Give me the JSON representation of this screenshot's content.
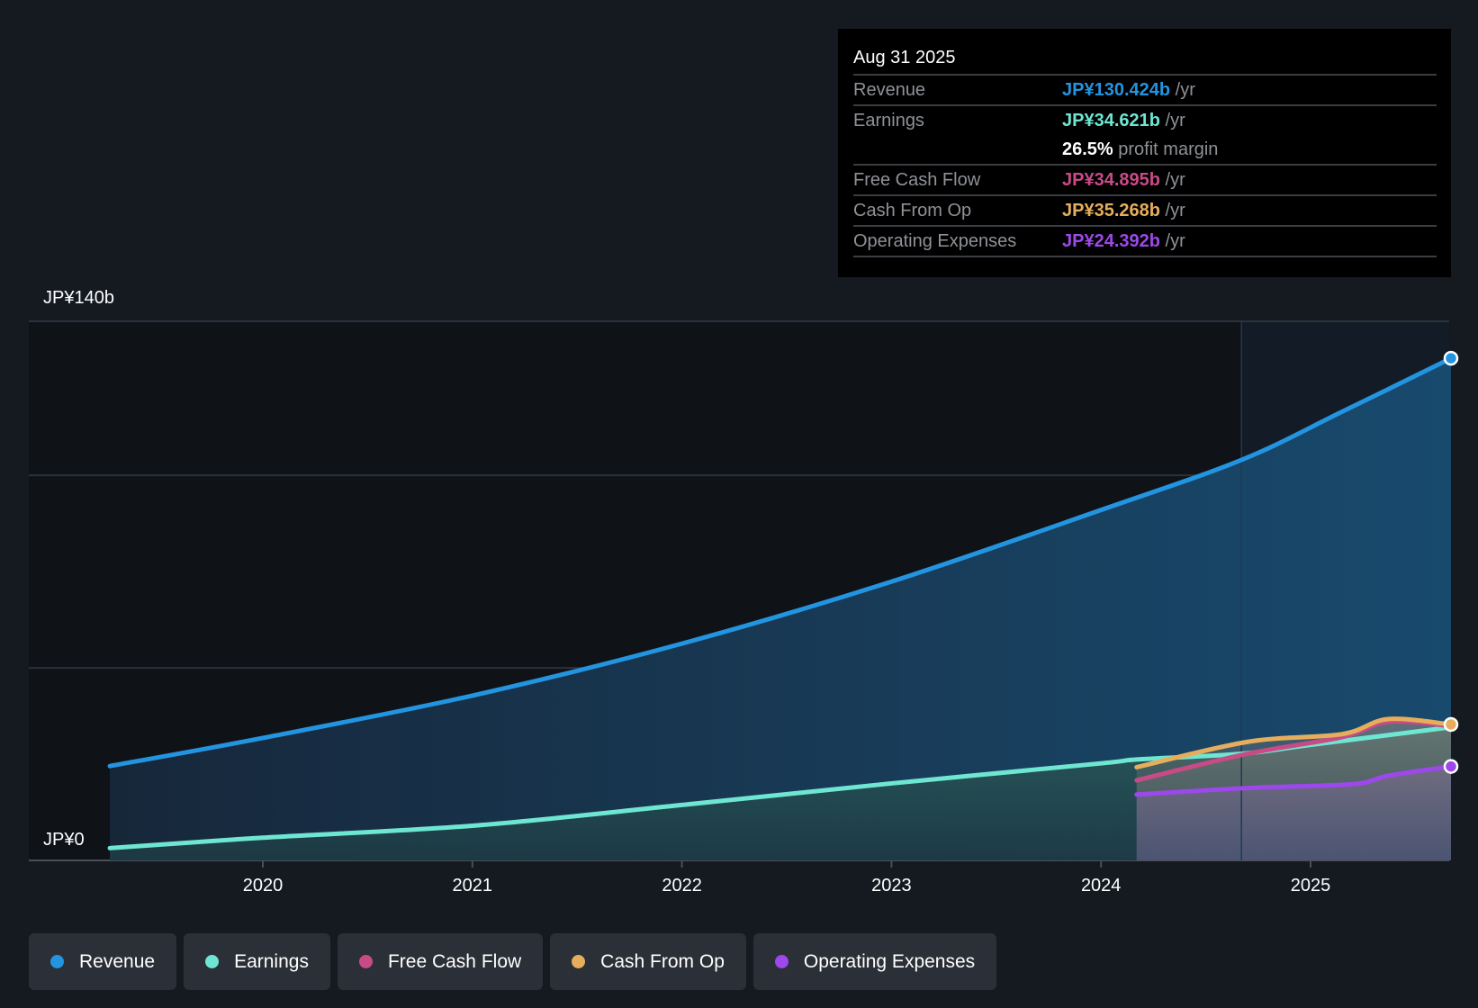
{
  "tooltip": {
    "date": "Aug 31 2025",
    "rows": [
      {
        "label": "Revenue",
        "value": "JP¥130.424b",
        "unit": " /yr",
        "color": "#2394e0"
      },
      {
        "label": "Earnings",
        "value": "JP¥34.621b",
        "unit": " /yr",
        "color": "#6ee6d2"
      },
      {
        "label": "",
        "value": "26.5%",
        "unit": " profit margin",
        "color": "#ffffff"
      },
      {
        "label": "Free Cash Flow",
        "value": "JP¥34.895b",
        "unit": " /yr",
        "color": "#c84b86"
      },
      {
        "label": "Cash From Op",
        "value": "JP¥35.268b",
        "unit": " /yr",
        "color": "#e6ae5c"
      },
      {
        "label": "Operating Expenses",
        "value": "JP¥24.392b",
        "unit": " /yr",
        "color": "#9d48ea"
      }
    ]
  },
  "chart_data": {
    "type": "line",
    "title": "",
    "xlabel": "",
    "ylabel": "",
    "ylim": [
      0,
      140
    ],
    "xlim": [
      2019.27,
      2025.67
    ],
    "y_tick_labels": [
      "JP¥140b",
      "JP¥0"
    ],
    "y_gridlines": [
      0,
      50,
      100,
      140
    ],
    "x_ticks": [
      2020,
      2021,
      2022,
      2023,
      2024,
      2025
    ],
    "x_tick_labels": [
      "2020",
      "2021",
      "2022",
      "2023",
      "2024",
      "2025"
    ],
    "highlight_region_start": 2024.67,
    "series": [
      {
        "name": "Revenue",
        "color": "#2394e0",
        "x": [
          2019.27,
          2020,
          2021,
          2022,
          2023,
          2024,
          2024.67,
          2025.15,
          2025.67
        ],
        "y": [
          24.5,
          31.8,
          42.8,
          56.3,
          72.4,
          91,
          104,
          116.5,
          130.4
        ]
      },
      {
        "name": "Earnings",
        "color": "#6ee6d2",
        "x": [
          2019.27,
          2020,
          2021,
          2022,
          2023,
          2024,
          2024.17,
          2024.67,
          2025,
          2025.67
        ],
        "y": [
          3.2,
          5.9,
          9,
          14.4,
          20,
          25.2,
          26.2,
          27.7,
          30,
          34.6
        ]
      },
      {
        "name": "Free Cash Flow",
        "color": "#c84b86",
        "x": [
          2024.17,
          2024.7,
          2025.15,
          2025.37,
          2025.67
        ],
        "y": [
          20.8,
          27.7,
          32,
          36,
          34.9
        ]
      },
      {
        "name": "Cash From Op",
        "color": "#e6ae5c",
        "x": [
          2024.17,
          2024.7,
          2025.15,
          2025.37,
          2025.67
        ],
        "y": [
          24.2,
          30.8,
          32.8,
          36.7,
          35.3
        ]
      },
      {
        "name": "Operating Expenses",
        "color": "#9d48ea",
        "x": [
          2024.17,
          2024.7,
          2025.2,
          2025.37,
          2025.67
        ],
        "y": [
          17.1,
          18.8,
          19.8,
          22,
          24.4
        ]
      }
    ]
  },
  "legend": [
    {
      "label": "Revenue",
      "color": "#2394e0"
    },
    {
      "label": "Earnings",
      "color": "#6ee6d2"
    },
    {
      "label": "Free Cash Flow",
      "color": "#c84b86"
    },
    {
      "label": "Cash From Op",
      "color": "#e6ae5c"
    },
    {
      "label": "Operating Expenses",
      "color": "#9d48ea"
    }
  ]
}
